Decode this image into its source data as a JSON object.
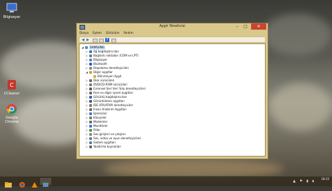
{
  "desktop": {
    "icons": [
      {
        "label": "Bilgisayar",
        "icon": "computer-icon"
      },
      {
        "label": "CCleaner",
        "icon": "ccleaner-icon"
      },
      {
        "label": "Google Chrome",
        "icon": "chrome-icon"
      }
    ]
  },
  "window": {
    "title": "Aygıt Yöneticisi",
    "menu": [
      "Dosya",
      "Eylem",
      "Görünüm",
      "Yardım"
    ],
    "controls": {
      "minimize": "–",
      "maximize": "□",
      "close": "✕"
    },
    "tree": {
      "root": "SAMSUNG",
      "items": [
        {
          "label": "Ağ bağdaştırıcıları",
          "expanded": false,
          "icon_color": "#3b78c2"
        },
        {
          "label": "Bağlantı noktaları (COM ve LPT)",
          "expanded": false,
          "icon_color": "#7a7a7a"
        },
        {
          "label": "Bilgisayar",
          "expanded": false,
          "icon_color": "#4a8ad2"
        },
        {
          "label": "Bluetooth",
          "expanded": false,
          "icon_color": "#2a5cc0"
        },
        {
          "label": "Depolama denetleyicileri",
          "expanded": false,
          "icon_color": "#8a8a8a"
        },
        {
          "label": "Diğer aygıtlar",
          "expanded": true,
          "icon_color": "#c9a23a"
        },
        {
          "label": "Bilinmeyen Aygıt",
          "child": true,
          "icon_color": "#d2b04a"
        },
        {
          "label": "Disk sürücüleri",
          "expanded": false,
          "icon_color": "#6a6a6a"
        },
        {
          "label": "DVD/CD-ROM sürücüleri",
          "expanded": false,
          "icon_color": "#7a7a7a"
        },
        {
          "label": "Evrensel Seri Veri Yolu denetleyicileri",
          "expanded": false,
          "icon_color": "#5a5a5a"
        },
        {
          "label": "Fare ve diğer işaret aygıtları",
          "expanded": false,
          "icon_color": "#6a6a6a"
        },
        {
          "label": "Görüntü bağdaştırıcıları",
          "expanded": false,
          "icon_color": "#3a6ab0"
        },
        {
          "label": "Görüntüleme aygıtları",
          "expanded": false,
          "icon_color": "#5a5a5a"
        },
        {
          "label": "IDE ATA/ATAPI denetleyiciler",
          "expanded": false,
          "icon_color": "#7a7a7a"
        },
        {
          "label": "İnsan Arabirim Aygıtları",
          "expanded": false,
          "icon_color": "#6a6a6a"
        },
        {
          "label": "İşlemciler",
          "expanded": false,
          "icon_color": "#4a7ab0"
        },
        {
          "label": "Klavyeler",
          "expanded": false,
          "icon_color": "#7a7a7a"
        },
        {
          "label": "Modemler",
          "expanded": false,
          "icon_color": "#6a6a6a"
        },
        {
          "label": "Monitörler",
          "expanded": false,
          "icon_color": "#3a7ad0"
        },
        {
          "label": "Piller",
          "expanded": false,
          "icon_color": "#4a9a4a"
        },
        {
          "label": "Ses girişleri ve çıkışları",
          "expanded": false,
          "icon_color": "#8a8a8a"
        },
        {
          "label": "Ses, video ve oyun denetleyicileri",
          "expanded": false,
          "icon_color": "#7a7a7a"
        },
        {
          "label": "Sistem aygıtları",
          "expanded": false,
          "icon_color": "#5a7ab0"
        },
        {
          "label": "Yazdırma kuyrukları",
          "expanded": false,
          "icon_color": "#6a6a6a"
        }
      ]
    }
  },
  "taskbar": {
    "time": "18:15",
    "date": "",
    "apps": [
      "windows-explorer",
      "firefox",
      "vlc",
      "device-manager"
    ]
  }
}
